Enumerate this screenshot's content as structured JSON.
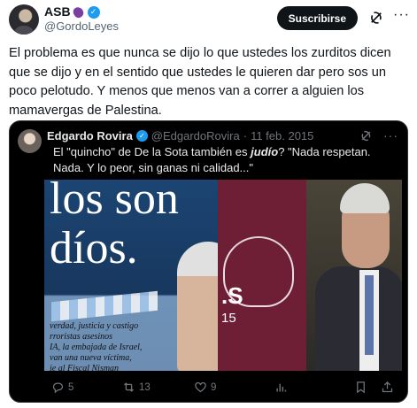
{
  "author": {
    "name": "ASB",
    "handle": "@GordoLeyes",
    "verified": true,
    "name_emoji": "eggplant-icon"
  },
  "header": {
    "subscribe_label": "Suscribirse",
    "more_label": "···"
  },
  "post": {
    "text": "El problema es que nunca se dijo lo que ustedes los zurditos dicen que se dijo y en el sentido que ustedes le quieren dar pero sos un poco pelotudo. Y menos que menos van a correr a alguien los mamavergas de Palestina."
  },
  "quoted": {
    "name": "Edgardo Rovira",
    "handle": "@EdgardoRovira",
    "separator": "·",
    "date": "11 feb. 2015",
    "more_label": "···",
    "text_before": "El \"quincho\" de De la Sota también es ",
    "text_highlight": "judío",
    "text_after": "? \"Nada respetan. Nada. Y lo peor, sin ganas ni calidad...\"",
    "media": {
      "line1": "los son",
      "line2": "díos.",
      "paper_lines": [
        "verdad, justicia y castigo",
        "rroristas asesinos",
        "IA, la embajada de Israel,",
        "van una nueva víctima,",
        "ie al Fiscal Nisman"
      ],
      "mid_letters": ".S",
      "mid_number": "15"
    },
    "stats": {
      "replies": "5",
      "reposts": "13",
      "likes": "9"
    }
  },
  "colors": {
    "accent": "#1d9bf0",
    "text": "#0f1419",
    "muted": "#536471",
    "card_bg": "#000000",
    "card_muted": "#71767b"
  }
}
